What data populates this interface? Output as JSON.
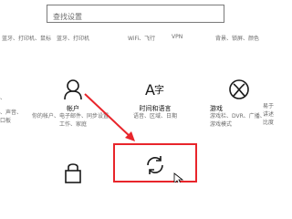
{
  "search": {
    "placeholder": "查找设置"
  },
  "top_row": {
    "items": [
      "蓝牙、打印机、鼠标",
      "蓝牙、打印机",
      "WiFi、飞行",
      "VPN",
      "背景、锁屏、颜色"
    ]
  },
  "left_edge": {
    "line1": "、",
    "line2": "、声音、",
    "line3": "口板"
  },
  "tiles": [
    {
      "title": "帐户",
      "sub1": "你的帐户、电子邮件、同步设置、",
      "sub2": "工作、家庭"
    },
    {
      "title": "时间和语言",
      "sub1": "语音、区域、日期"
    },
    {
      "title": "游戏",
      "sub1": "游戏栏、DVR、广播、",
      "sub2": "游戏模式"
    }
  ],
  "right_edge": {
    "line1": "易于",
    "line2": "讲述",
    "line3": "比度"
  },
  "icons": {
    "account": "person-icon",
    "time_language": "language-icon",
    "gaming": "xbox-icon",
    "privacy": "lock-icon",
    "update": "sync-icon"
  },
  "colors": {
    "icon": "#1a1a1a",
    "highlight": "#e8252b",
    "arrow": "#e8252b"
  }
}
